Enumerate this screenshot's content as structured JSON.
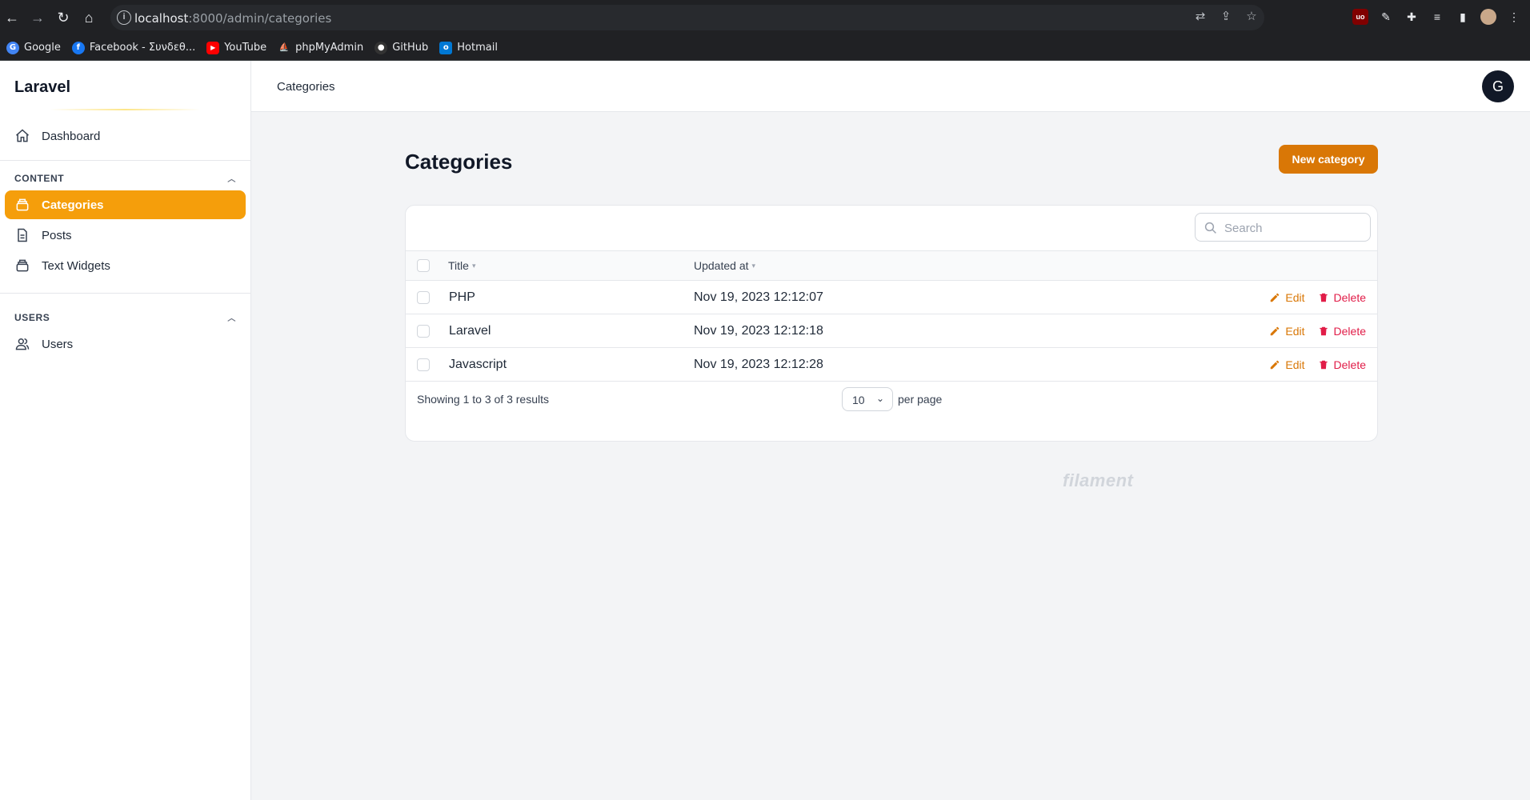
{
  "browser": {
    "url_host": "localhost",
    "url_path": ":8000/admin/categories",
    "bookmarks": [
      {
        "label": "Google",
        "color": "#4285f4",
        "glyph": "G"
      },
      {
        "label": "Facebook - Συνδεθ...",
        "color": "#1877f2",
        "glyph": "f"
      },
      {
        "label": "YouTube",
        "color": "#ff0000",
        "glyph": "▶"
      },
      {
        "label": "phpMyAdmin",
        "color": "#f29111",
        "glyph": "⛵"
      },
      {
        "label": "GitHub",
        "color": "#333333",
        "glyph": "●"
      },
      {
        "label": "Hotmail",
        "color": "#0078d4",
        "glyph": "o"
      }
    ]
  },
  "sidebar": {
    "brand": "Laravel",
    "dashboard_label": "Dashboard",
    "groups": [
      {
        "label": "CONTENT",
        "items": [
          "Categories",
          "Posts",
          "Text Widgets"
        ]
      },
      {
        "label": "USERS",
        "items": [
          "Users"
        ]
      }
    ],
    "active_item": "Categories"
  },
  "topbar": {
    "breadcrumb": "Categories",
    "avatar_initial": "G"
  },
  "page": {
    "title": "Categories",
    "new_button": "New category"
  },
  "table": {
    "search_placeholder": "Search",
    "columns": [
      "Title",
      "Updated at"
    ],
    "rows": [
      {
        "title": "PHP",
        "updated_at": "Nov 19, 2023 12:12:07"
      },
      {
        "title": "Laravel",
        "updated_at": "Nov 19, 2023 12:12:18"
      },
      {
        "title": "Javascript",
        "updated_at": "Nov 19, 2023 12:12:28"
      }
    ],
    "edit_label": "Edit",
    "delete_label": "Delete",
    "showing_text": "Showing 1 to 3 of 3 results",
    "per_page_value": "10",
    "per_page_label": "per page"
  },
  "footer": {
    "brand": "filament"
  },
  "colors": {
    "accent": "#f59e0b",
    "primary_button": "#d97706",
    "danger": "#e11d48"
  }
}
